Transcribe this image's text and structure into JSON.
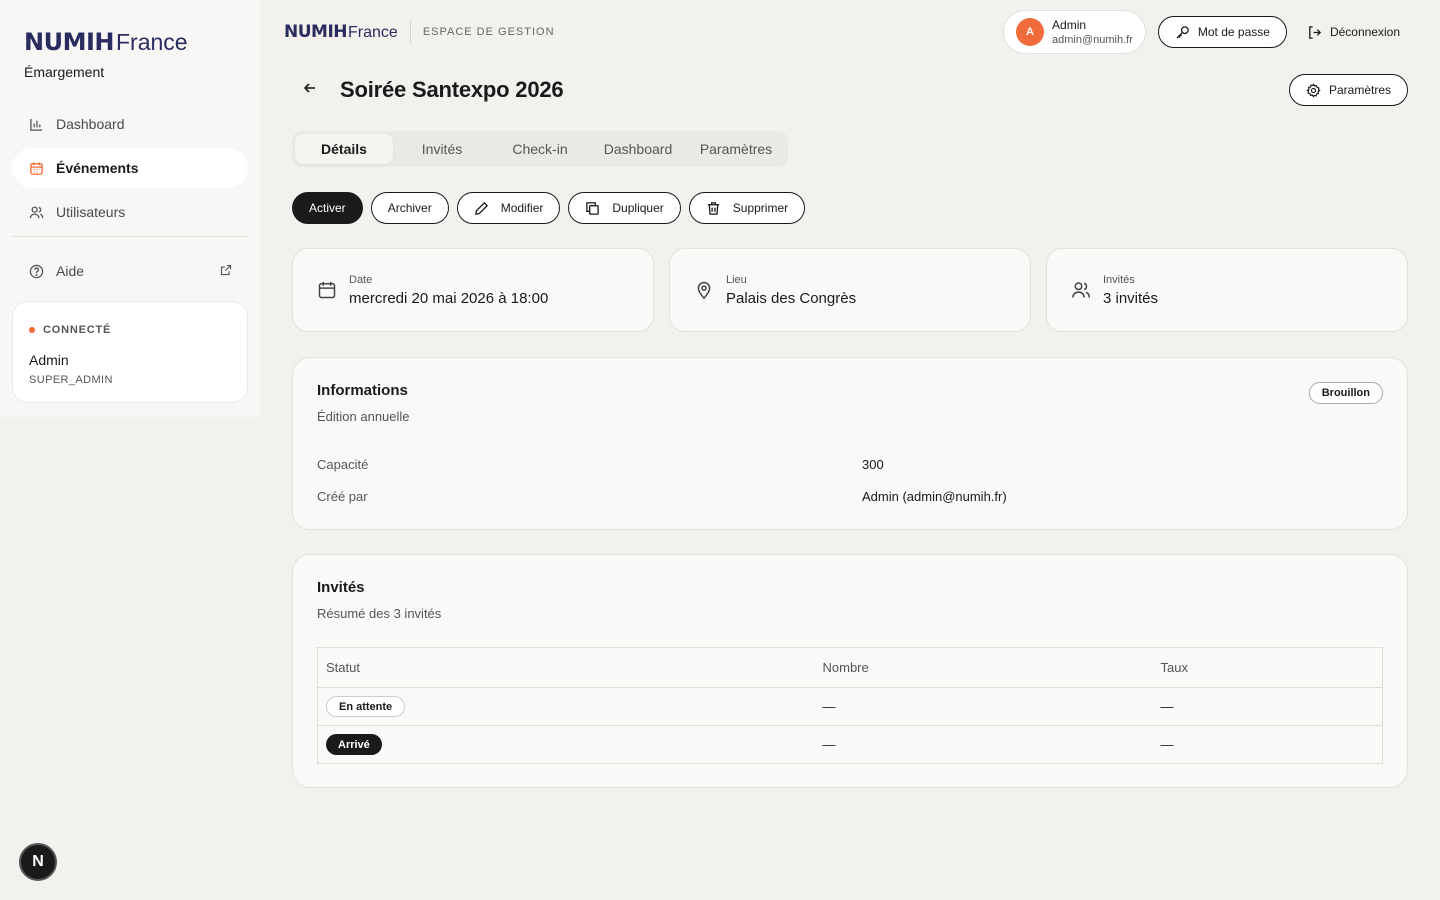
{
  "brand": {
    "logo_main": "NUMIH",
    "logo_suffix": "France",
    "app_name": "Émargement"
  },
  "sidebar": {
    "items": [
      {
        "label": "Dashboard",
        "icon": "chart-bar-icon"
      },
      {
        "label": "Événements",
        "icon": "calendar-icon",
        "active": true
      },
      {
        "label": "Utilisateurs",
        "icon": "users-icon"
      }
    ],
    "help": {
      "label": "Aide",
      "icon": "help-circle-icon"
    },
    "user_card": {
      "status": "CONNECTÉ",
      "name": "Admin",
      "role": "SUPER_ADMIN"
    }
  },
  "topbar": {
    "space_label": "ESPACE DE GESTION",
    "user": {
      "initial": "A",
      "name": "Admin",
      "email": "admin@numih.fr"
    },
    "password_label": "Mot de passe",
    "logout_label": "Déconnexion"
  },
  "page": {
    "title": "Soirée Santexpo 2026",
    "settings_label": "Paramètres"
  },
  "tabs": [
    "Détails",
    "Invités",
    "Check-in",
    "Dashboard",
    "Paramètres"
  ],
  "actions": {
    "activate": "Activer",
    "archive": "Archiver",
    "edit": "Modifier",
    "duplicate": "Dupliquer",
    "delete": "Supprimer"
  },
  "cards": {
    "date": {
      "label": "Date",
      "value": "mercredi 20 mai 2026 à 18:00"
    },
    "place": {
      "label": "Lieu",
      "value": "Palais des Congrès"
    },
    "guests": {
      "label": "Invités",
      "value": "3 invités"
    }
  },
  "info": {
    "title": "Informations",
    "subtitle": "Édition annuelle",
    "status_badge": "Brouillon",
    "rows": [
      {
        "key": "Capacité",
        "value": "300"
      },
      {
        "key": "Créé par",
        "value": "Admin (admin@numih.fr)"
      }
    ]
  },
  "guests_panel": {
    "title": "Invités",
    "subtitle": "Résumé des 3 invités",
    "columns": [
      "Statut",
      "Nombre",
      "Taux"
    ],
    "rows": [
      {
        "status": "En attente",
        "count": "—",
        "rate": "—"
      },
      {
        "status": "Arrivé",
        "count": "—",
        "rate": "—"
      }
    ]
  },
  "colors": {
    "accent": "#f26b3a",
    "brand": "#2a2c5f",
    "dark": "#1a1a1a"
  }
}
